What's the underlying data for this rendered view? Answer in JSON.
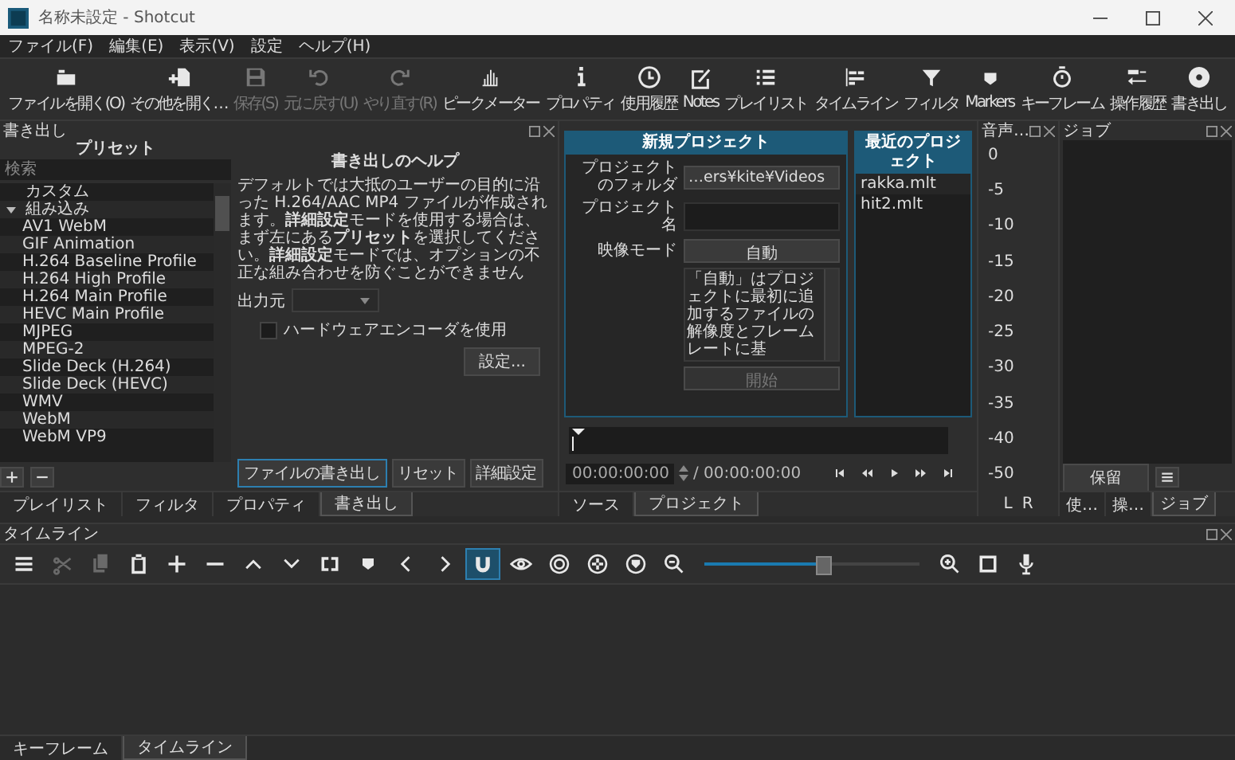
{
  "window": {
    "title": "名称未設定 - Shotcut"
  },
  "menu": [
    "ファイル(F)",
    "編集(E)",
    "表示(V)",
    "設定",
    "ヘルプ(H)"
  ],
  "toolbar": [
    {
      "label": "ファイルを開く(O)",
      "kind": "open",
      "disabled": false
    },
    {
      "label": "その他を開く…",
      "kind": "open-other",
      "disabled": false
    },
    {
      "label": "保存(S)",
      "kind": "save",
      "disabled": true
    },
    {
      "label": "元に戻す(U)",
      "kind": "undo",
      "disabled": true
    },
    {
      "label": "やり直す(R)",
      "kind": "redo",
      "disabled": true
    },
    {
      "label": "ピークメーター",
      "kind": "peak",
      "disabled": false
    },
    {
      "label": "プロパティ",
      "kind": "info",
      "disabled": false
    },
    {
      "label": "使用履歴",
      "kind": "clock",
      "disabled": false
    },
    {
      "label": "Notes",
      "kind": "notes",
      "disabled": false
    },
    {
      "label": "プレイリスト",
      "kind": "list",
      "disabled": false
    },
    {
      "label": "タイムライン",
      "kind": "timeline",
      "disabled": false
    },
    {
      "label": "フィルタ",
      "kind": "filter",
      "disabled": false
    },
    {
      "label": "Markers",
      "kind": "marker",
      "disabled": false
    },
    {
      "label": "キーフレーム",
      "kind": "stopwatch",
      "disabled": false
    },
    {
      "label": "操作履歴",
      "kind": "history",
      "disabled": false
    },
    {
      "label": "書き出し",
      "kind": "disc",
      "disabled": false
    }
  ],
  "export": {
    "title": "書き出し",
    "presets_title": "プリセット",
    "search": {
      "placeholder": "検索"
    },
    "presets": [
      {
        "label": "カスタム"
      },
      {
        "label": "組み込み",
        "expanded": true,
        "children": [
          {
            "label": "AV1 WebM"
          },
          {
            "label": "GIF Animation"
          },
          {
            "label": "H.264 Baseline Profile"
          },
          {
            "label": "H.264 High Profile"
          },
          {
            "label": "H.264 Main Profile"
          },
          {
            "label": "HEVC Main Profile"
          },
          {
            "label": "MJPEG"
          },
          {
            "label": "MPEG-2"
          },
          {
            "label": "Slide Deck (H.264)"
          },
          {
            "label": "Slide Deck (HEVC)"
          },
          {
            "label": "WMV"
          },
          {
            "label": "WebM"
          },
          {
            "label": "WebM VP9"
          }
        ]
      }
    ],
    "help_title": "書き出しのヘルプ",
    "help_text": "デフォルトでは大抵のユーザーの目的に沿った H.264/AAC MP4 ファイルが作成されます。**詳細設定**モードを使用する場合は、まず左にある**プリセット**を選択してください。**詳細設定**モードでは、オプションの不正な組み合わせを防ぐことができません",
    "source_label": "出力元",
    "hw_encoder": {
      "label": "ハードウェアエンコーダを使用",
      "checked": false
    },
    "settings_button": "設定...",
    "buttons": [
      "ファイルの書き出し",
      "リセット",
      "詳細設定"
    ]
  },
  "left_tabs": [
    {
      "label": "プレイリスト",
      "selected": false
    },
    {
      "label": "フィルタ",
      "selected": false
    },
    {
      "label": "プロパティ",
      "selected": false
    },
    {
      "label": "書き出し",
      "selected": true
    }
  ],
  "new_project": {
    "title": "新規プロジェクト",
    "folder_label": "プロジェクトのフォルダ",
    "folder_value": "…ers¥kite¥Videos",
    "name_label": "プロジェクト名",
    "mode_label": "映像モード",
    "mode_value": "自動",
    "description": "「自動」はプロジェクトに最初に追加するファイルの解像度とフレームレートに基",
    "start": {
      "label": "開始",
      "disabled": true
    }
  },
  "recent_projects": {
    "title": "最近のプロジェクト",
    "items": [
      "rakka.mlt",
      "hit2.mlt"
    ]
  },
  "player": {
    "position": "00:00:00:00",
    "duration": "/ 00:00:00:00"
  },
  "player_tabs": [
    {
      "label": "ソース",
      "selected": false
    },
    {
      "label": "プロジェクト",
      "selected": true
    }
  ],
  "audio_meter": {
    "title": "音声…",
    "scale": [
      "0",
      "-5",
      "-10",
      "-15",
      "-20",
      "-25",
      "-30",
      "-35",
      "-40",
      "-50"
    ],
    "channels": [
      "L",
      "R"
    ]
  },
  "jobs": {
    "title": "ジョブ",
    "pause_button": "保留",
    "tabs": [
      {
        "label": "使…",
        "selected": false
      },
      {
        "label": "操…",
        "selected": false
      },
      {
        "label": "ジョブ",
        "selected": true
      }
    ]
  },
  "timeline": {
    "title": "タイムライン",
    "tools": [
      {
        "kind": "menu",
        "disabled": false,
        "on": false
      },
      {
        "kind": "scissors",
        "disabled": true,
        "on": false
      },
      {
        "kind": "copy",
        "disabled": true,
        "on": false
      },
      {
        "kind": "paste",
        "disabled": false,
        "on": false
      },
      {
        "kind": "plus",
        "disabled": false,
        "on": false
      },
      {
        "kind": "minus",
        "disabled": false,
        "on": false
      },
      {
        "kind": "up",
        "disabled": false,
        "on": false
      },
      {
        "kind": "down",
        "disabled": false,
        "on": false
      },
      {
        "kind": "split",
        "disabled": false,
        "on": false
      },
      {
        "kind": "marker",
        "disabled": false,
        "on": false
      },
      {
        "kind": "left",
        "disabled": false,
        "on": false
      },
      {
        "kind": "right",
        "disabled": false,
        "on": false
      },
      {
        "kind": "magnet",
        "disabled": false,
        "on": true
      },
      {
        "kind": "eye",
        "disabled": false,
        "on": false
      },
      {
        "kind": "target",
        "disabled": false,
        "on": false
      },
      {
        "kind": "asterisk",
        "disabled": false,
        "on": false
      },
      {
        "kind": "shield",
        "disabled": false,
        "on": false
      },
      {
        "kind": "zoom-out",
        "disabled": false,
        "on": false
      }
    ],
    "zoom_slider": {
      "level": 0.55
    },
    "tools_end": [
      {
        "kind": "zoom-in",
        "disabled": false,
        "on": false
      },
      {
        "kind": "fit",
        "disabled": false,
        "on": false
      },
      {
        "kind": "mic",
        "disabled": false,
        "on": false
      }
    ]
  },
  "bottom_tabs": [
    {
      "label": "キーフレーム",
      "selected": false
    },
    {
      "label": "タイムライン",
      "selected": true
    }
  ]
}
